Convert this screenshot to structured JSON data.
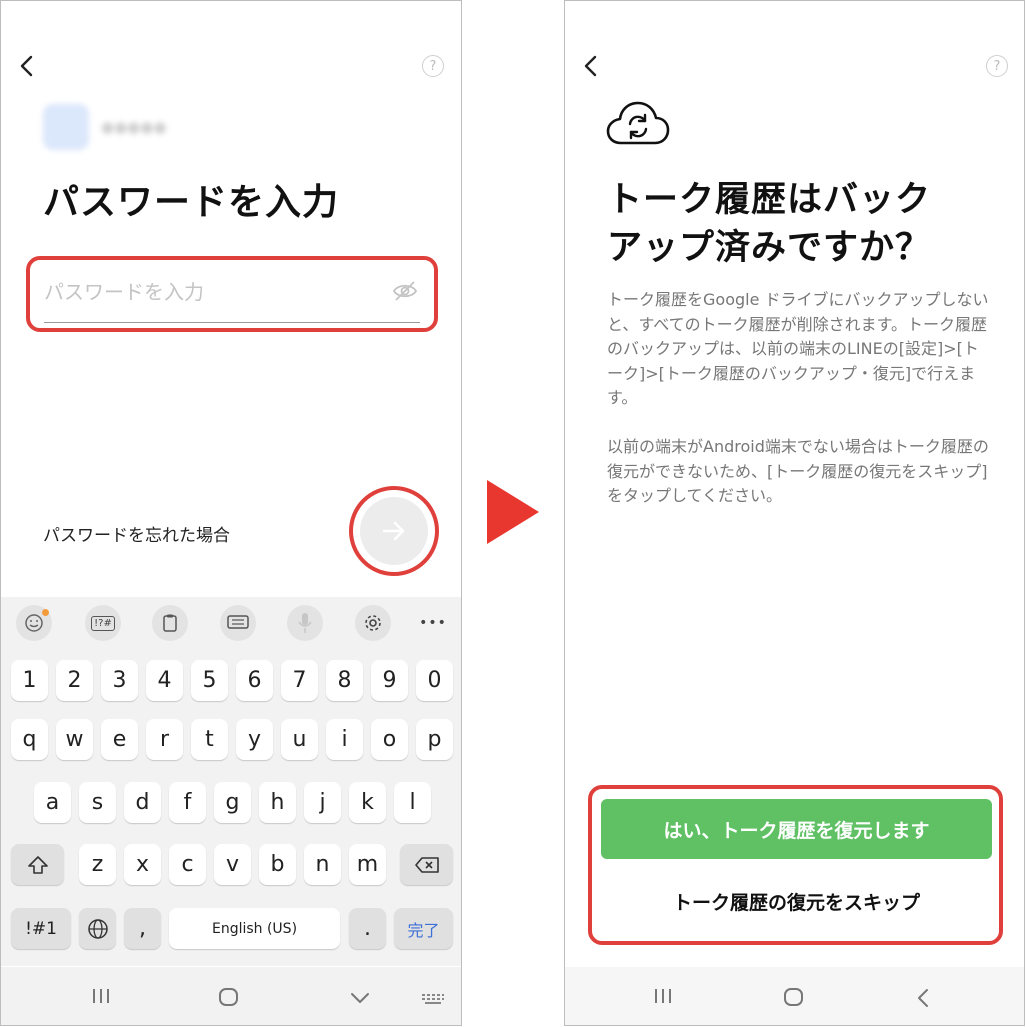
{
  "left_screen": {
    "help_label": "?",
    "title": "パスワードを入力",
    "password_placeholder": "パスワードを入力",
    "forgot_link": "パスワードを忘れた場合",
    "keyboard": {
      "toolbar": [
        "emoji-icon",
        "symbols-icon",
        "clipboard-icon",
        "keyboard-layout-icon",
        "mic-icon",
        "gear-icon",
        "more-icon"
      ],
      "toolbar_symbols_label": "!?#",
      "more_label": "•••",
      "row_numbers": [
        "1",
        "2",
        "3",
        "4",
        "5",
        "6",
        "7",
        "8",
        "9",
        "0"
      ],
      "row_1": [
        "q",
        "w",
        "e",
        "r",
        "t",
        "y",
        "u",
        "i",
        "o",
        "p"
      ],
      "row_2": [
        "a",
        "s",
        "d",
        "f",
        "g",
        "h",
        "j",
        "k",
        "l"
      ],
      "row_3": [
        "z",
        "x",
        "c",
        "v",
        "b",
        "n",
        "m"
      ],
      "symbols_key": "!#1",
      "comma_key": ",",
      "space_key": "English (US)",
      "period_key": ".",
      "done_key": "完了"
    }
  },
  "right_screen": {
    "help_label": "?",
    "title_line1": "トーク履歴はバック",
    "title_line2": "アップ済みですか？",
    "description_1": "トーク履歴をGoogle ドライブにバックアップしないと、すべてのトーク履歴が削除されます。トーク履歴のバックアップは、以前の端末のLINEの[設定]>[トーク]>[トーク履歴のバックアップ・復元]で行えます。",
    "description_2": "以前の端末がAndroid端末でない場合はトーク履歴の復元ができないため、[トーク履歴の復元をスキップ]をタップしてください。",
    "restore_button": "はい、トーク履歴を復元します",
    "skip_button": "トーク履歴の復元をスキップ"
  },
  "colors": {
    "highlight": "#e0403c",
    "line_green": "#5fc064",
    "arrow": "#e8372e"
  }
}
